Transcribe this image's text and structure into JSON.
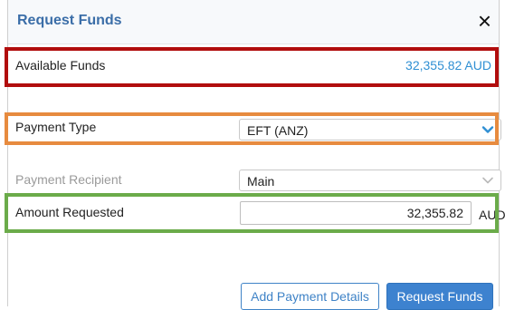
{
  "dialog": {
    "title": "Request Funds",
    "close_symbol": "×"
  },
  "available_funds": {
    "label": "Available Funds",
    "value": "32,355.82 AUD"
  },
  "payment_type": {
    "label": "Payment Type",
    "selected": "EFT (ANZ)"
  },
  "payment_recipient": {
    "label": "Payment Recipient",
    "selected": "Main"
  },
  "amount_requested": {
    "label": "Amount Requested",
    "value": "32,355.82",
    "unit": "AUD"
  },
  "buttons": {
    "add_payment_details": "Add Payment Details",
    "request_funds": "Request Funds"
  },
  "colors": {
    "title": "#3b6ea8",
    "accent": "#2f8fd3",
    "highlight_available_funds": "#b10d0d",
    "highlight_payment_type": "#e78b3f",
    "highlight_amount_requested": "#6bab4a"
  },
  "icons": {
    "close": "close-icon",
    "dropdown": "chevron-down-icon"
  }
}
